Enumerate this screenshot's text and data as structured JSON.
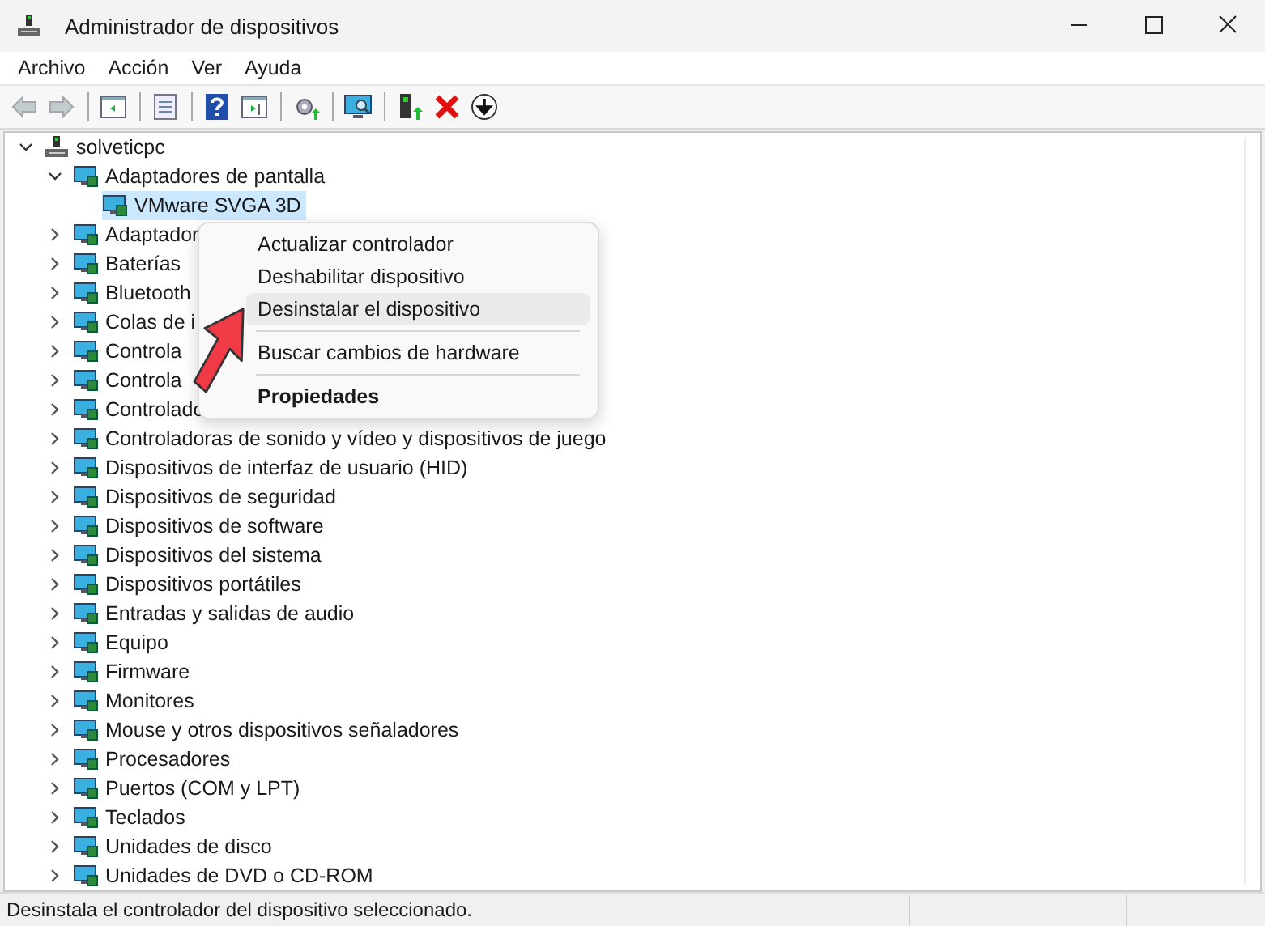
{
  "window": {
    "title": "Administrador de dispositivos"
  },
  "menu_bar": [
    "Archivo",
    "Acción",
    "Ver",
    "Ayuda"
  ],
  "toolbar": [
    {
      "kind": "back",
      "disabled": true
    },
    {
      "kind": "forward",
      "disabled": true
    },
    {
      "kind": "separator"
    },
    {
      "kind": "panel"
    },
    {
      "kind": "separator"
    },
    {
      "kind": "sheet"
    },
    {
      "kind": "separator"
    },
    {
      "kind": "help"
    },
    {
      "kind": "panel2"
    },
    {
      "kind": "separator"
    },
    {
      "kind": "update"
    },
    {
      "kind": "separator"
    },
    {
      "kind": "scan"
    },
    {
      "kind": "separator"
    },
    {
      "kind": "enable"
    },
    {
      "kind": "remove"
    },
    {
      "kind": "down"
    }
  ],
  "tree": [
    {
      "label": "solveticpc",
      "expanded": true,
      "selected": false,
      "children": [
        {
          "label": "Adaptadores de pantalla",
          "expanded": true,
          "selected": false,
          "children": [
            {
              "label": "VMware SVGA 3D",
              "selected": true
            }
          ]
        },
        {
          "label": "Adaptador",
          "expanded": false,
          "selected": false
        },
        {
          "label": "Baterías",
          "expanded": false,
          "selected": false
        },
        {
          "label": "Bluetooth",
          "expanded": false,
          "selected": false
        },
        {
          "label": "Colas de i",
          "expanded": false,
          "selected": false
        },
        {
          "label": "Controla",
          "expanded": false,
          "selected": false
        },
        {
          "label": "Controla",
          "expanded": false,
          "selected": false
        },
        {
          "label": "Controlado",
          "expanded": false,
          "selected": false
        },
        {
          "label": "Controladoras de sonido y vídeo y dispositivos de juego",
          "expanded": false,
          "selected": false
        },
        {
          "label": "Dispositivos de interfaz de usuario (HID)",
          "expanded": false,
          "selected": false
        },
        {
          "label": "Dispositivos de seguridad",
          "expanded": false,
          "selected": false
        },
        {
          "label": "Dispositivos de software",
          "expanded": false,
          "selected": false
        },
        {
          "label": "Dispositivos del sistema",
          "expanded": false,
          "selected": false
        },
        {
          "label": "Dispositivos portátiles",
          "expanded": false,
          "selected": false
        },
        {
          "label": "Entradas y salidas de audio",
          "expanded": false,
          "selected": false
        },
        {
          "label": "Equipo",
          "expanded": false,
          "selected": false
        },
        {
          "label": "Firmware",
          "expanded": false,
          "selected": false
        },
        {
          "label": "Monitores",
          "expanded": false,
          "selected": false
        },
        {
          "label": "Mouse y otros dispositivos señaladores",
          "expanded": false,
          "selected": false
        },
        {
          "label": "Procesadores",
          "expanded": false,
          "selected": false
        },
        {
          "label": "Puertos (COM y LPT)",
          "expanded": false,
          "selected": false
        },
        {
          "label": "Teclados",
          "expanded": false,
          "selected": false
        },
        {
          "label": "Unidades de disco",
          "expanded": false,
          "selected": false
        },
        {
          "label": "Unidades de DVD o CD-ROM",
          "expanded": false,
          "selected": false
        }
      ]
    }
  ],
  "context_menu": [
    {
      "kind": "item",
      "label": "Actualizar controlador",
      "selected": false,
      "default": false
    },
    {
      "kind": "item",
      "label": "Deshabilitar dispositivo",
      "selected": false,
      "default": false
    },
    {
      "kind": "item",
      "label": "Desinstalar el dispositivo",
      "selected": true,
      "default": false
    },
    {
      "kind": "separator"
    },
    {
      "kind": "item",
      "label": "Buscar cambios de hardware",
      "selected": false,
      "default": false
    },
    {
      "kind": "separator"
    },
    {
      "kind": "item",
      "label": "Propiedades",
      "selected": false,
      "default": true
    }
  ],
  "status_bar": {
    "text": "Desinstala el controlador del dispositivo seleccionado."
  }
}
